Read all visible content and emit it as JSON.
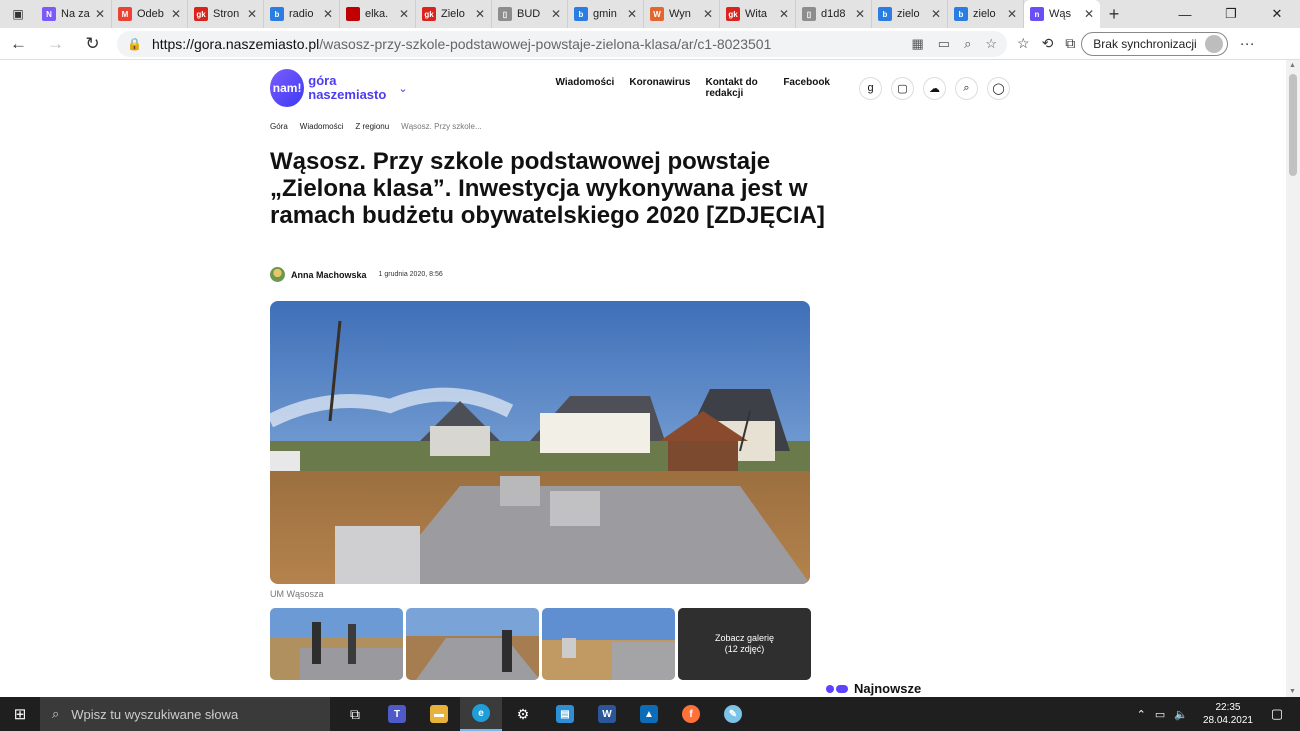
{
  "browser": {
    "tabs": [
      {
        "title": "Na za",
        "fav_color": "#7a5af8",
        "fav_text": "N"
      },
      {
        "title": "Odeb",
        "fav_color": "#ea4335",
        "fav_text": "M"
      },
      {
        "title": "Stron",
        "fav_color": "#d9231d",
        "fav_text": "gk"
      },
      {
        "title": "radio",
        "fav_color": "#2a7de1",
        "fav_text": "b"
      },
      {
        "title": "elka.",
        "fav_color": "#c00000",
        "fav_text": ""
      },
      {
        "title": "Zielo",
        "fav_color": "#d9231d",
        "fav_text": "gk"
      },
      {
        "title": "BUD",
        "fav_color": "#8d8d8d",
        "fav_text": "▯"
      },
      {
        "title": "gmin",
        "fav_color": "#2a7de1",
        "fav_text": "b"
      },
      {
        "title": "Wyn",
        "fav_color": "#e2662e",
        "fav_text": "W"
      },
      {
        "title": "Wita",
        "fav_color": "#d9231d",
        "fav_text": "gk"
      },
      {
        "title": "d1d8",
        "fav_color": "#8d8d8d",
        "fav_text": "▯"
      },
      {
        "title": "zielo",
        "fav_color": "#2a7de1",
        "fav_text": "b"
      },
      {
        "title": "zielo",
        "fav_color": "#2a7de1",
        "fav_text": "b"
      },
      {
        "title": "Wąs",
        "fav_color": "#6b4ff5",
        "fav_text": "n"
      }
    ],
    "active_tab_index": 13,
    "url_host": "https://gora.naszemiasto.pl",
    "url_path": "/wasosz-przy-szkole-podstawowej-powstaje-zielona-klasa/ar/c1-8023501",
    "sync_label": "Brak synchronizacji"
  },
  "site": {
    "logo_badge": "nam!",
    "logo_line1": "góra",
    "logo_line2": "naszemiasto",
    "nav": [
      "Wiadomości",
      "Koronawirus",
      "Kontakt do redakcji",
      "Facebook"
    ]
  },
  "breadcrumb": [
    "Góra",
    "Wiadomości",
    "Z regionu",
    "Wąsosz. Przy szkole..."
  ],
  "article": {
    "title": "Wąsosz. Przy szkole podstawowej powstaje „Zielona klasa”. Inwestycja wykonywana jest w ramach budżetu obywatelskiego 2020 [ZDJĘCIA]",
    "author": "Anna Machowska",
    "date": "1 grudnia 2020, 8:56",
    "photo_caption": "UM Wąsosza",
    "gallery_cta_line1": "Zobacz galerię",
    "gallery_cta_line2": "(12 zdjęć)"
  },
  "sidebar": {
    "section_title": "Najnowsze"
  },
  "taskbar": {
    "search_placeholder": "Wpisz tu wyszukiwane słowa",
    "time": "22:35",
    "date": "28.04.2021"
  }
}
